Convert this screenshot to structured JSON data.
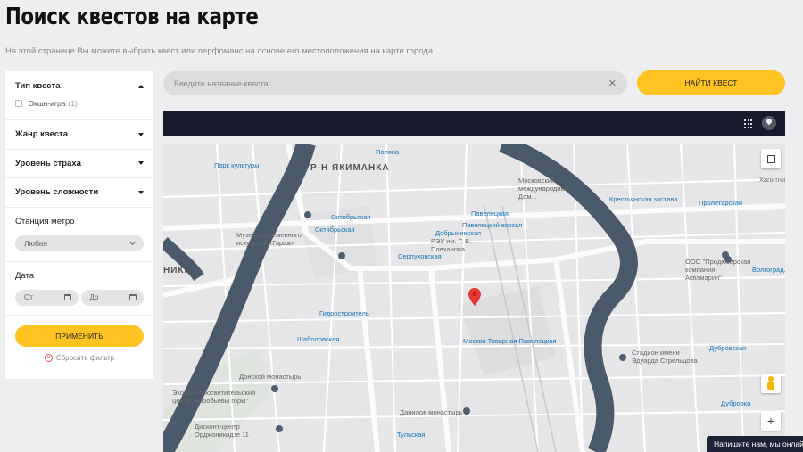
{
  "page": {
    "title": "Поиск квестов на карте",
    "subtitle": "На этой странице Вы можете выбрать квест или перфоманс на основе его местоположения на карте города."
  },
  "filters": {
    "quest_type": {
      "label": "Тип квеста",
      "option": "Экшн-игра",
      "option_count": "(1)"
    },
    "genre": "Жанр квеста",
    "fear_level": "Уровень страха",
    "difficulty": "Уровень сложности",
    "metro": {
      "label": "Станция метро",
      "value": "Любая"
    },
    "date": {
      "label": "Дата",
      "from": "От",
      "to": "До"
    },
    "apply": "ПРИМЕНИТЬ",
    "reset": "Сбросить фильтр"
  },
  "search": {
    "placeholder": "Введите название квеста",
    "button": "НАЙТИ КВЕСТ"
  },
  "map": {
    "labels": [
      "Поляна",
      "Парк культуры",
      "Р-Н ЯКИМАНКА",
      "Московский международный Дом...",
      "Крестьянская застава",
      "Хапитни...",
      "Пролетарская",
      "Октябрьская",
      "Октябрьская",
      "Павелецкая",
      "Музей современного искусства «Гараж»",
      "Павелецкий вокзал",
      "Добрынинская",
      "РЭУ им. Г. В. Плеханова",
      "Серпуховская",
      "ООО \"Продюсерская компания Аквамарин\"",
      "Волгоград...",
      "НИКИ",
      "Гидростроитель",
      "Шаболовская",
      "Москва Товарная Павелецкая",
      "Стадион имени Эдуарда Стрельцова",
      "Дубровская",
      "Донской монастырь",
      "Эколого-просветительский центр \"Воробьёвы горы\"",
      "Данилов монастырь",
      "Дубровка",
      "Дисконт-центр Орджоникидзе 11",
      "Тульская"
    ]
  },
  "chat": {
    "label": "Напишите нам, мы онлайн!"
  }
}
